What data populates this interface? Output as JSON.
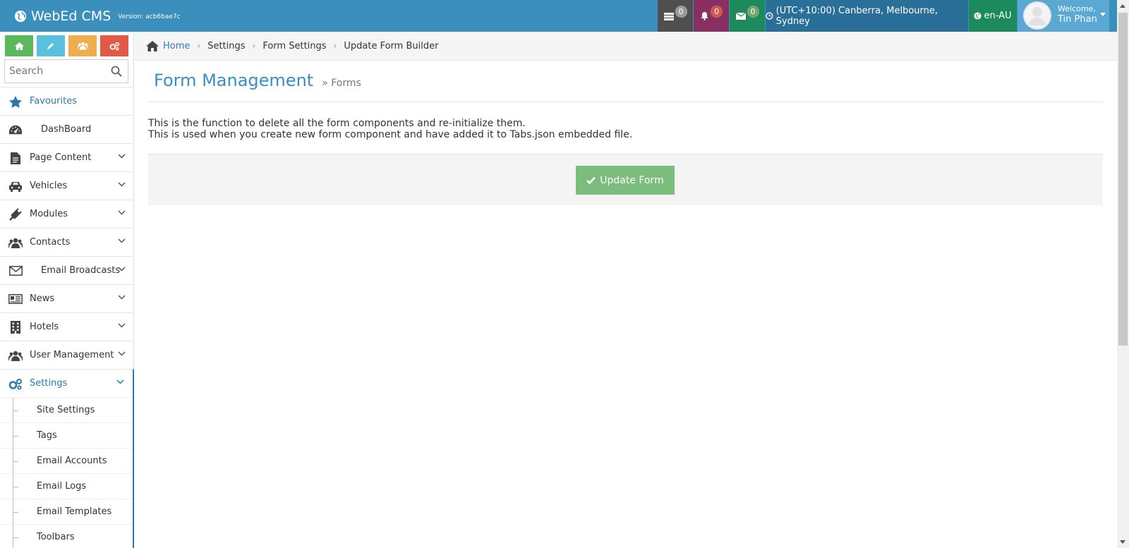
{
  "app": {
    "brand_name": "WebEd CMS",
    "version": "Version: acb6bae7c"
  },
  "topbar": {
    "tasks_count": "0",
    "notifications_count": "0",
    "messages_count": "0",
    "timezone": "(UTC+10:00) Canberra, Melbourne, Sydney",
    "language": "en-AU",
    "welcome": "Welcome,",
    "user_name": "Tin Phan"
  },
  "sidebar": {
    "search_placeholder": "Search",
    "items": [
      {
        "label": "Favourites",
        "icon": "star-icon"
      },
      {
        "label": "DashBoard",
        "icon": "dashboard-icon"
      },
      {
        "label": "Page Content",
        "icon": "file-icon"
      },
      {
        "label": "Vehicles",
        "icon": "car-icon"
      },
      {
        "label": "Modules",
        "icon": "plug-icon"
      },
      {
        "label": "Contacts",
        "icon": "users-icon"
      },
      {
        "label": "Email Broadcasts",
        "icon": "envelope-icon"
      },
      {
        "label": "News",
        "icon": "newspaper-icon"
      },
      {
        "label": "Hotels",
        "icon": "building-icon"
      },
      {
        "label": "User Management",
        "icon": "users-icon"
      },
      {
        "label": "Settings",
        "icon": "cogs-icon"
      }
    ],
    "settings_sub": [
      {
        "label": "Site Settings"
      },
      {
        "label": "Tags"
      },
      {
        "label": "Email Accounts"
      },
      {
        "label": "Email Logs"
      },
      {
        "label": "Email Templates"
      },
      {
        "label": "Toolbars"
      }
    ]
  },
  "breadcrumb": {
    "home": "Home",
    "settings": "Settings",
    "form_settings": "Form Settings",
    "current": "Update Form Builder"
  },
  "main": {
    "title": "Form Management",
    "subtitle": "» Forms",
    "description_line1": "This is the function to delete all the form components and re-initialize them.",
    "description_line2": "This is used when you create new form component and have added it to Tabs.json embedded file.",
    "update_button": "Update Form"
  },
  "colors": {
    "topbar": "#3a8fbd",
    "accent": "#2a7ab0",
    "success_button": "#7bbd7d"
  }
}
